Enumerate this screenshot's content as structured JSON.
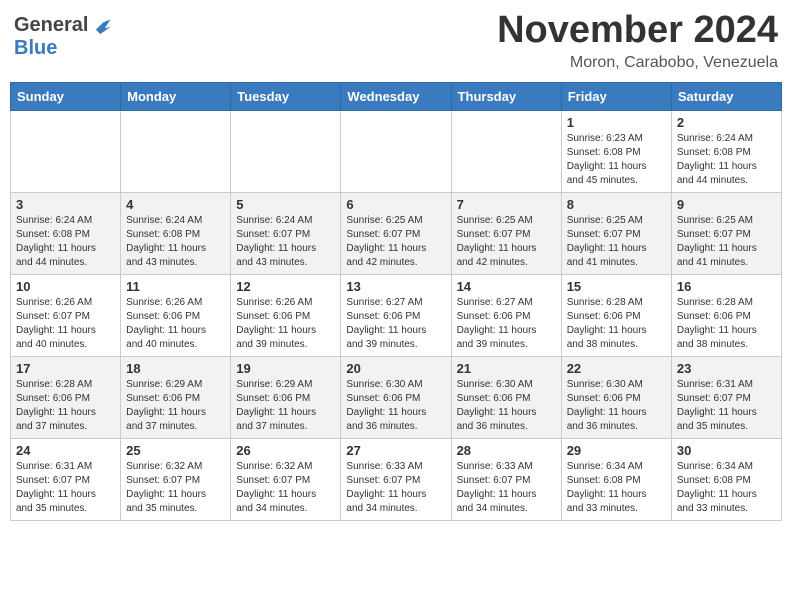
{
  "header": {
    "logo_general": "General",
    "logo_blue": "Blue",
    "month_title": "November 2024",
    "location": "Moron, Carabobo, Venezuela"
  },
  "weekdays": [
    "Sunday",
    "Monday",
    "Tuesday",
    "Wednesday",
    "Thursday",
    "Friday",
    "Saturday"
  ],
  "weeks": [
    [
      {
        "day": "",
        "info": ""
      },
      {
        "day": "",
        "info": ""
      },
      {
        "day": "",
        "info": ""
      },
      {
        "day": "",
        "info": ""
      },
      {
        "day": "",
        "info": ""
      },
      {
        "day": "1",
        "info": "Sunrise: 6:23 AM\nSunset: 6:08 PM\nDaylight: 11 hours and 45 minutes."
      },
      {
        "day": "2",
        "info": "Sunrise: 6:24 AM\nSunset: 6:08 PM\nDaylight: 11 hours and 44 minutes."
      }
    ],
    [
      {
        "day": "3",
        "info": "Sunrise: 6:24 AM\nSunset: 6:08 PM\nDaylight: 11 hours and 44 minutes."
      },
      {
        "day": "4",
        "info": "Sunrise: 6:24 AM\nSunset: 6:08 PM\nDaylight: 11 hours and 43 minutes."
      },
      {
        "day": "5",
        "info": "Sunrise: 6:24 AM\nSunset: 6:07 PM\nDaylight: 11 hours and 43 minutes."
      },
      {
        "day": "6",
        "info": "Sunrise: 6:25 AM\nSunset: 6:07 PM\nDaylight: 11 hours and 42 minutes."
      },
      {
        "day": "7",
        "info": "Sunrise: 6:25 AM\nSunset: 6:07 PM\nDaylight: 11 hours and 42 minutes."
      },
      {
        "day": "8",
        "info": "Sunrise: 6:25 AM\nSunset: 6:07 PM\nDaylight: 11 hours and 41 minutes."
      },
      {
        "day": "9",
        "info": "Sunrise: 6:25 AM\nSunset: 6:07 PM\nDaylight: 11 hours and 41 minutes."
      }
    ],
    [
      {
        "day": "10",
        "info": "Sunrise: 6:26 AM\nSunset: 6:07 PM\nDaylight: 11 hours and 40 minutes."
      },
      {
        "day": "11",
        "info": "Sunrise: 6:26 AM\nSunset: 6:06 PM\nDaylight: 11 hours and 40 minutes."
      },
      {
        "day": "12",
        "info": "Sunrise: 6:26 AM\nSunset: 6:06 PM\nDaylight: 11 hours and 39 minutes."
      },
      {
        "day": "13",
        "info": "Sunrise: 6:27 AM\nSunset: 6:06 PM\nDaylight: 11 hours and 39 minutes."
      },
      {
        "day": "14",
        "info": "Sunrise: 6:27 AM\nSunset: 6:06 PM\nDaylight: 11 hours and 39 minutes."
      },
      {
        "day": "15",
        "info": "Sunrise: 6:28 AM\nSunset: 6:06 PM\nDaylight: 11 hours and 38 minutes."
      },
      {
        "day": "16",
        "info": "Sunrise: 6:28 AM\nSunset: 6:06 PM\nDaylight: 11 hours and 38 minutes."
      }
    ],
    [
      {
        "day": "17",
        "info": "Sunrise: 6:28 AM\nSunset: 6:06 PM\nDaylight: 11 hours and 37 minutes."
      },
      {
        "day": "18",
        "info": "Sunrise: 6:29 AM\nSunset: 6:06 PM\nDaylight: 11 hours and 37 minutes."
      },
      {
        "day": "19",
        "info": "Sunrise: 6:29 AM\nSunset: 6:06 PM\nDaylight: 11 hours and 37 minutes."
      },
      {
        "day": "20",
        "info": "Sunrise: 6:30 AM\nSunset: 6:06 PM\nDaylight: 11 hours and 36 minutes."
      },
      {
        "day": "21",
        "info": "Sunrise: 6:30 AM\nSunset: 6:06 PM\nDaylight: 11 hours and 36 minutes."
      },
      {
        "day": "22",
        "info": "Sunrise: 6:30 AM\nSunset: 6:06 PM\nDaylight: 11 hours and 36 minutes."
      },
      {
        "day": "23",
        "info": "Sunrise: 6:31 AM\nSunset: 6:07 PM\nDaylight: 11 hours and 35 minutes."
      }
    ],
    [
      {
        "day": "24",
        "info": "Sunrise: 6:31 AM\nSunset: 6:07 PM\nDaylight: 11 hours and 35 minutes."
      },
      {
        "day": "25",
        "info": "Sunrise: 6:32 AM\nSunset: 6:07 PM\nDaylight: 11 hours and 35 minutes."
      },
      {
        "day": "26",
        "info": "Sunrise: 6:32 AM\nSunset: 6:07 PM\nDaylight: 11 hours and 34 minutes."
      },
      {
        "day": "27",
        "info": "Sunrise: 6:33 AM\nSunset: 6:07 PM\nDaylight: 11 hours and 34 minutes."
      },
      {
        "day": "28",
        "info": "Sunrise: 6:33 AM\nSunset: 6:07 PM\nDaylight: 11 hours and 34 minutes."
      },
      {
        "day": "29",
        "info": "Sunrise: 6:34 AM\nSunset: 6:08 PM\nDaylight: 11 hours and 33 minutes."
      },
      {
        "day": "30",
        "info": "Sunrise: 6:34 AM\nSunset: 6:08 PM\nDaylight: 11 hours and 33 minutes."
      }
    ]
  ]
}
